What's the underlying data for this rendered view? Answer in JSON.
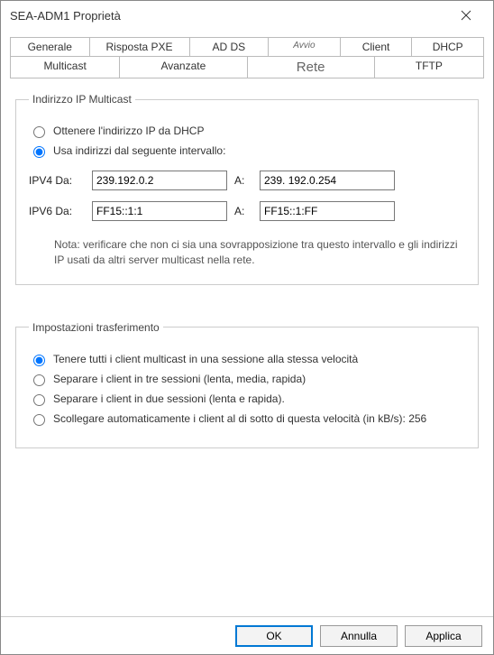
{
  "window": {
    "title": "SEA-ADM1 Proprietà"
  },
  "tabs": {
    "row1": [
      "Generale",
      "Risposta PXE",
      "AD DS",
      "Avvio",
      "Client",
      "DHCP"
    ],
    "row2": [
      "Multicast",
      "Avanzate",
      "Rete",
      "TFTP"
    ]
  },
  "group1": {
    "legend": "Indirizzo IP Multicast",
    "opt_dhcp": "Ottenere l'indirizzo IP da DHCP",
    "opt_range": "Usa indirizzi dal seguente intervallo:",
    "ipv4_label": "IPV4 Da:",
    "ipv4_from": "239.192.0.2",
    "ipv4_to_label": "A:",
    "ipv4_to": "239. 192.0.254",
    "ipv6_label": "IPV6 Da:",
    "ipv6_from": "FF15::1:1",
    "ipv6_to_label": "A:",
    "ipv6_to": "FF15::1:FF",
    "note": "Nota: verificare che non ci sia una sovrapposizione tra questo intervallo e gli indirizzi IP usati da altri server multicast nella rete."
  },
  "group2": {
    "legend": "Impostazioni trasferimento",
    "opt1": "Tenere tutti i client multicast in una sessione alla stessa velocità",
    "opt2": "Separare i client in tre sessioni (lenta, media, rapida)",
    "opt3": "Separare i client in due sessioni (lenta e rapida).",
    "opt4": "Scollegare automaticamente i client al di sotto di questa velocità (in kB/s): 256"
  },
  "buttons": {
    "ok": "OK",
    "cancel": "Annulla",
    "apply": "Applica"
  }
}
